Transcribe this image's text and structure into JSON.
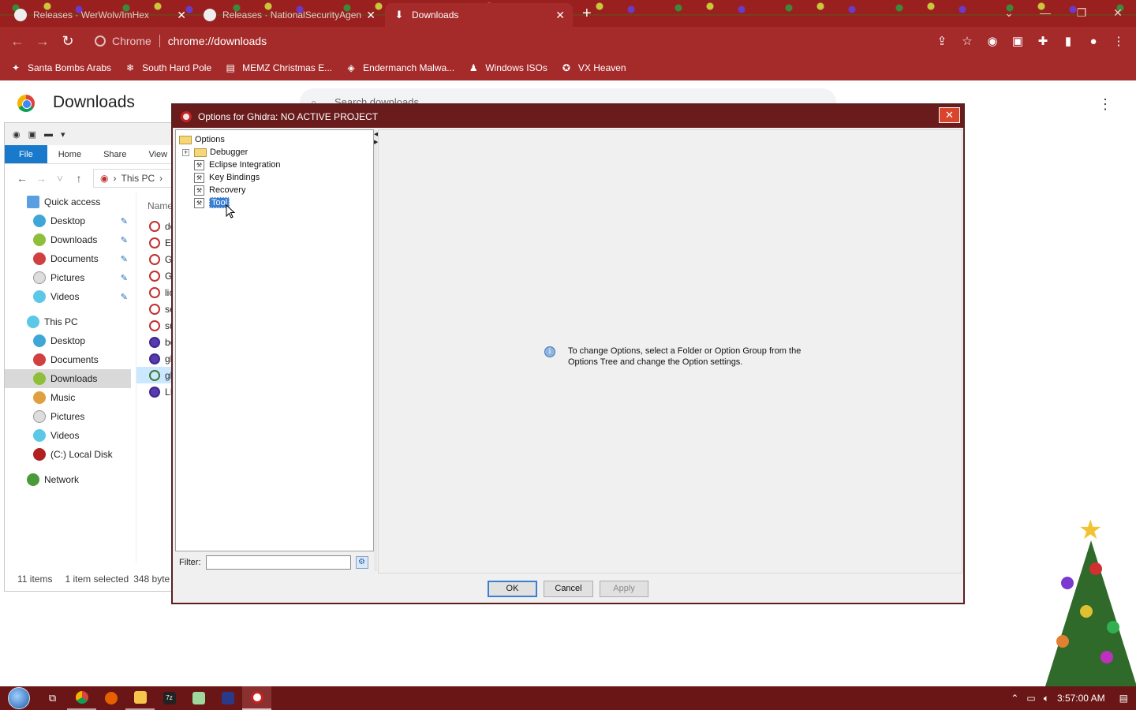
{
  "browser": {
    "tabs": [
      {
        "title": "Releases · WerWolv/ImHex",
        "active": false,
        "icon": "github-icon"
      },
      {
        "title": "Releases · NationalSecurityAgen",
        "active": false,
        "icon": "github-icon"
      },
      {
        "title": "Downloads",
        "active": true,
        "icon": "download-icon"
      }
    ],
    "omnibox": {
      "chip": "Chrome",
      "url": "chrome://downloads"
    },
    "bookmarks": [
      {
        "label": "Santa Bombs Arabs",
        "icon": "bomb-icon"
      },
      {
        "label": "South Hard Pole",
        "icon": "snowflake-icon"
      },
      {
        "label": "MEMZ Christmas E...",
        "icon": "page-icon"
      },
      {
        "label": "Endermanch Malwa...",
        "icon": "raccoon-icon"
      },
      {
        "label": "Windows ISOs",
        "icon": "person-icon"
      },
      {
        "label": "VX Heaven",
        "icon": "vx-icon"
      }
    ]
  },
  "downloads_page": {
    "title": "Downloads",
    "search_placeholder": "Search downloads"
  },
  "explorer": {
    "ribbon_tabs": [
      "File",
      "Home",
      "Share",
      "View"
    ],
    "address": [
      "This PC"
    ],
    "quick_access_label": "Quick access",
    "quick_access": [
      "Desktop",
      "Downloads",
      "Documents",
      "Pictures",
      "Videos"
    ],
    "this_pc_label": "This PC",
    "this_pc": [
      "Desktop",
      "Documents",
      "Downloads",
      "Music",
      "Pictures",
      "Videos",
      "(C:) Local Disk"
    ],
    "network_label": "Network",
    "column_name": "Name",
    "files": [
      "do",
      "Ex",
      "Gl",
      "Gl",
      "lic",
      "se",
      "su",
      "bo",
      "gh",
      "gh",
      "LI"
    ],
    "status": {
      "items": "11 items",
      "selected": "1 item selected",
      "size": "348 byte"
    }
  },
  "dialog": {
    "title": "Options for Ghidra: NO ACTIVE PROJECT",
    "tree": {
      "root": "Options",
      "folders": [
        "Debugger"
      ],
      "leaves": [
        "Eclipse Integration",
        "Key Bindings",
        "Recovery",
        "Tool"
      ],
      "selected": "Tool"
    },
    "filter_label": "Filter:",
    "filter_value": "",
    "info_line1": "To change Options, select a Folder or Option Group from the",
    "info_line2": "Options Tree and change the Option settings.",
    "buttons": {
      "ok": "OK",
      "cancel": "Cancel",
      "apply": "Apply"
    }
  },
  "taskbar": {
    "apps": [
      "task-view",
      "chrome",
      "firefox",
      "file-explorer",
      "7zip",
      "notepad",
      "terminal",
      "ghidra"
    ],
    "clock": "3:57:00 AM"
  },
  "colors": {
    "chrome_frame": "#a52a2a",
    "dialog_title": "#6a1c1c",
    "selection": "#3c7fd1",
    "taskbar": "#6a1616"
  }
}
